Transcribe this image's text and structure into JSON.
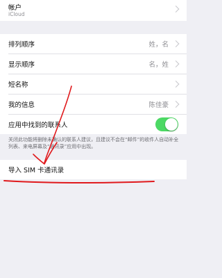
{
  "account": {
    "title": "帐户",
    "subtitle": "iCloud"
  },
  "settings": {
    "sort_order": {
      "label": "排列顺序",
      "value": "姓，名"
    },
    "display_order": {
      "label": "显示顺序",
      "value": "名，姓"
    },
    "short_name": {
      "label": "短名称"
    },
    "my_info": {
      "label": "我的信息",
      "value": "陈佳豪"
    },
    "contacts_found_in_apps": {
      "label": "应用中找到的联系人",
      "enabled": true
    }
  },
  "footnote": "关闭此功能将删除未确认的联系人建议，且建议不会在“邮件”的收件人自动补全列表、来电屏幕及“通讯录”应用中出现。",
  "import_sim": {
    "label": "导入 SIM 卡通讯录"
  },
  "colors": {
    "toggle_on": "#4cd964",
    "link": "#007aff",
    "annotation": "#e0191c"
  }
}
